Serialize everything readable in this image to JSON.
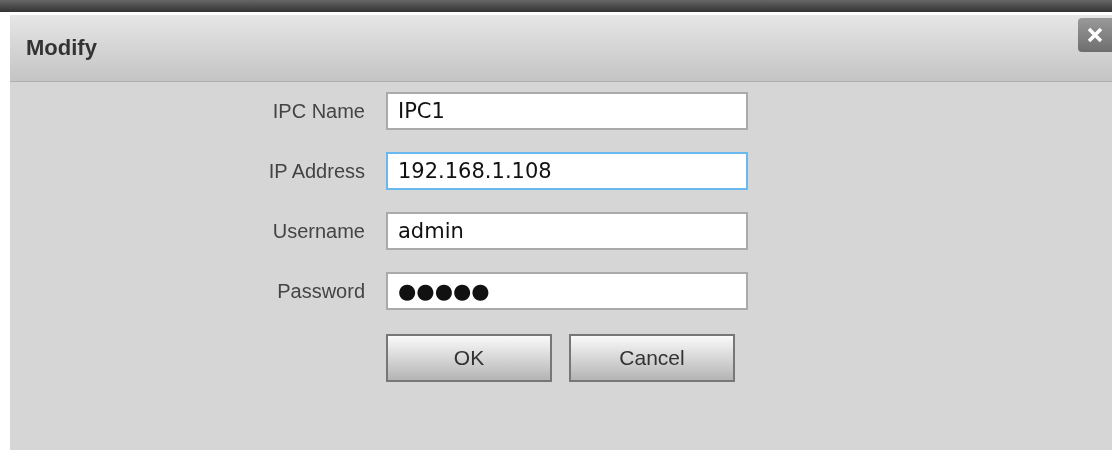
{
  "dialog": {
    "title": "Modify"
  },
  "fields": [
    {
      "label": "IPC Name",
      "value": "IPC1",
      "focused": false
    },
    {
      "label": "IP Address",
      "value": "192.168.1.108",
      "focused": true
    },
    {
      "label": "Username",
      "value": "admin",
      "focused": false
    },
    {
      "label": "Password",
      "value": "●●●●●",
      "focused": false
    }
  ],
  "buttons": [
    "OK",
    "Cancel"
  ]
}
